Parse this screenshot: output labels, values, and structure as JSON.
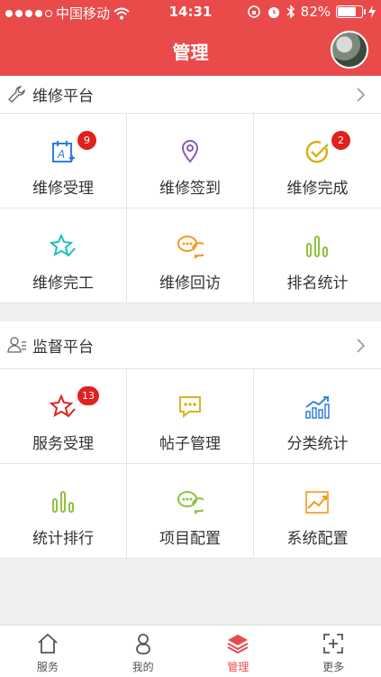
{
  "status_bar": {
    "carrier": "中国移动",
    "time": "14:31",
    "battery_percent": "82%",
    "battery_level": 0.82
  },
  "nav": {
    "title": "管理"
  },
  "sections": [
    {
      "title": "维修平台",
      "items": [
        {
          "label": "维修受理",
          "badge": "9",
          "icon": "calendar-a-plus-icon",
          "color": "#2f7fd6"
        },
        {
          "label": "维修签到",
          "badge": "",
          "icon": "location-pin-icon",
          "color": "#8a58b8"
        },
        {
          "label": "维修完成",
          "badge": "2",
          "icon": "check-circle-icon",
          "color": "#d7b21a"
        },
        {
          "label": "维修完工",
          "badge": "",
          "icon": "star-check-icon",
          "color": "#1dbfc0"
        },
        {
          "label": "维修回访",
          "badge": "",
          "icon": "chat-bubbles-icon",
          "color": "#f29a1e"
        },
        {
          "label": "排名统计",
          "badge": "",
          "icon": "bar-chart-icon",
          "color": "#8fc33b"
        }
      ]
    },
    {
      "title": "监督平台",
      "items": [
        {
          "label": "服务受理",
          "badge": "13",
          "icon": "star-check-icon",
          "color": "#e0211d"
        },
        {
          "label": "帖子管理",
          "badge": "",
          "icon": "chat-dots-icon",
          "color": "#d9b41e"
        },
        {
          "label": "分类统计",
          "badge": "",
          "icon": "chart-trend-icon",
          "color": "#3b86d8"
        },
        {
          "label": "统计排行",
          "badge": "",
          "icon": "bar-chart-icon",
          "color": "#8fc33b"
        },
        {
          "label": "项目配置",
          "badge": "",
          "icon": "chat-bubbles-icon",
          "color": "#8fc33b"
        },
        {
          "label": "系统配置",
          "badge": "",
          "icon": "chart-trend-icon",
          "color": "#f29a1e"
        }
      ]
    }
  ],
  "tabbar": {
    "items": [
      {
        "label": "服务",
        "icon": "home-icon",
        "active": false
      },
      {
        "label": "我的",
        "icon": "person-icon",
        "active": false
      },
      {
        "label": "管理",
        "icon": "layers-icon",
        "active": true
      },
      {
        "label": "更多",
        "icon": "plus-frame-icon",
        "active": false
      }
    ],
    "active_color": "#e94b4b"
  }
}
